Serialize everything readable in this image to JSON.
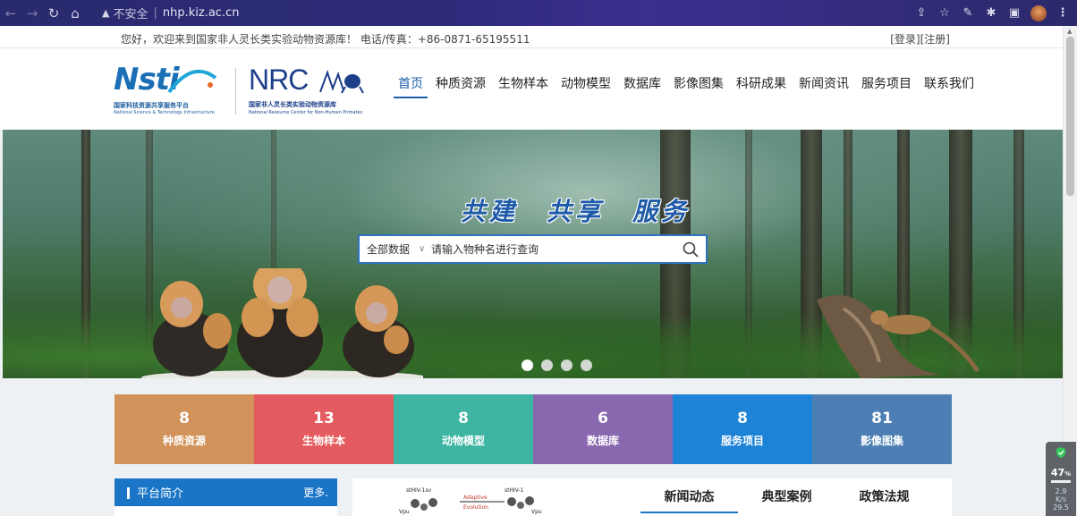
{
  "browser": {
    "insecure_label": "不安全",
    "url": "nhp.kiz.ac.cn"
  },
  "topbar": {
    "greeting": "您好，欢迎来到国家非人灵长类实验动物资源库！ 电话/传真：+86-0871-65195511",
    "login": "[登录]",
    "register": "[注册]"
  },
  "logos": {
    "nsti": {
      "wordmark": "Nsti",
      "cn": "国家科技资源共享服务平台",
      "en": "National Science & Technology Infrastructure"
    },
    "nrc": {
      "wordmark": "NRC",
      "cn": "国家非人灵长类实验动物资源库",
      "en": "National Resource Center for Non-Human Primates"
    }
  },
  "nav": {
    "items": [
      {
        "label": "首页"
      },
      {
        "label": "种质资源"
      },
      {
        "label": "生物样本"
      },
      {
        "label": "动物模型"
      },
      {
        "label": "数据库"
      },
      {
        "label": "影像图集"
      },
      {
        "label": "科研成果"
      },
      {
        "label": "新闻资讯"
      },
      {
        "label": "服务项目"
      },
      {
        "label": "联系我们"
      }
    ],
    "active_index": 0
  },
  "banner": {
    "slogan": "共建　共享　服务",
    "search": {
      "scope": "全部数据",
      "placeholder": "请输入物种名进行查询"
    },
    "carousel_count": 4,
    "carousel_active": 0
  },
  "stats": [
    {
      "count": "8",
      "label": "种质资源",
      "color": "#d2935a"
    },
    {
      "count": "13",
      "label": "生物样本",
      "color": "#e35b5e"
    },
    {
      "count": "8",
      "label": "动物模型",
      "color": "#3db5a2"
    },
    {
      "count": "6",
      "label": "数据库",
      "color": "#8a68b0"
    },
    {
      "count": "8",
      "label": "服务项目",
      "color": "#1d83d6"
    },
    {
      "count": "81",
      "label": "影像图集",
      "color": "#4d7fb5"
    }
  ],
  "platform_panel": {
    "title": "平台简介",
    "more": "更多."
  },
  "news": {
    "image_texts": [
      "stHIV-1sv",
      "Adaptive",
      "Evolution",
      "stHIV-1",
      "Vpu",
      "Vpu"
    ],
    "tabs": [
      {
        "label": "新闻动态"
      },
      {
        "label": "典型案例"
      },
      {
        "label": "政策法规"
      }
    ],
    "active_tab": 0
  },
  "net_widget": {
    "percent": "47",
    "percent_unit": "%",
    "speed": "2.9",
    "speed_unit": "K/s",
    "speed2": "29.5"
  }
}
